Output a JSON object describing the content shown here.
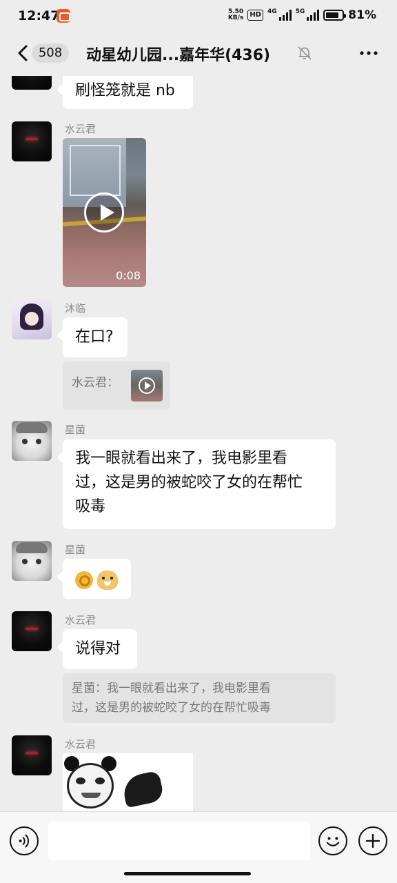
{
  "status_bar": {
    "time": "12:47",
    "net_speed_value": "5.50",
    "net_speed_unit": "KB/s",
    "hd_label": "HD",
    "network_1": "4G",
    "network_2": "5G",
    "battery_percent": "81%",
    "battery_level": 0.81
  },
  "header": {
    "unread_count": "508",
    "title": "动星幼儿园...嘉年华(436)",
    "mute_icon": "bell-muted-icon",
    "more_icon": "more-dots-icon",
    "back_icon": "chevron-left-icon"
  },
  "messages": [
    {
      "type": "text",
      "avatar": "dark-figure",
      "text": "刷怪笼就是 nb"
    },
    {
      "type": "video",
      "sender": "水云君",
      "avatar": "dark-figure",
      "duration": "0:08"
    },
    {
      "type": "text",
      "sender": "沐临",
      "avatar": "anime-girl",
      "text": "在口?",
      "quote": {
        "prefix": "水云君：",
        "kind": "video-thumbnail"
      }
    },
    {
      "type": "text",
      "sender": "星菌",
      "avatar": "cat",
      "lines": [
        "我一眼就看出来了，我电影里看",
        "过，这是男的被蛇咬了女的在帮忙",
        "吸毒"
      ]
    },
    {
      "type": "emoji",
      "sender": "星菌",
      "avatar": "cat",
      "emojis": [
        "ok-hand-emoji",
        "doge-emoji"
      ]
    },
    {
      "type": "text",
      "sender": "水云君",
      "avatar": "dark-figure",
      "text": "说得对",
      "quote": {
        "lines": [
          "星菌：我一眼就看出来了，我电影里看",
          "过，这是男的被蛇咬了女的在帮忙吸毒"
        ]
      }
    },
    {
      "type": "sticker",
      "sender": "水云君",
      "avatar": "dark-figure",
      "sticker": "panda-meme-sticker"
    }
  ],
  "input_bar": {
    "voice_icon": "voice-icon",
    "emoji_icon": "emoji-icon",
    "plus_icon": "plus-icon",
    "input_value": ""
  },
  "colors": {
    "background": "#ededed",
    "bubble": "#ffffff",
    "quote": "#e3e3e3",
    "sender_name": "#8a8a8a"
  }
}
